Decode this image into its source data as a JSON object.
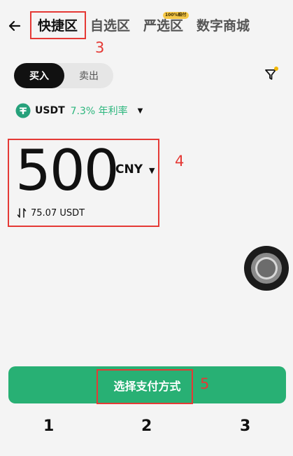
{
  "header": {
    "tabs": [
      {
        "label": "快捷区",
        "active": true
      },
      {
        "label": "自选区",
        "active": false
      },
      {
        "label": "严选区",
        "active": false,
        "badge": "100%赔付"
      },
      {
        "label": "数字商城",
        "active": false
      }
    ]
  },
  "annotations": {
    "tabs_marker": "3",
    "amount_marker": "4",
    "cta_marker": "5"
  },
  "trade_toggle": {
    "buy": "买入",
    "sell": "卖出"
  },
  "coin": {
    "name": "USDT",
    "rate": "7.3% 年利率"
  },
  "amount": {
    "value": "500",
    "currency": "CNY",
    "equivalent": "75.07 USDT"
  },
  "cta": {
    "label": "选择支付方式"
  },
  "bottom_numbers": [
    "1",
    "2",
    "3"
  ],
  "colors": {
    "accent": "#28b074",
    "rate": "#2cb67d",
    "annotation": "#e53935"
  }
}
